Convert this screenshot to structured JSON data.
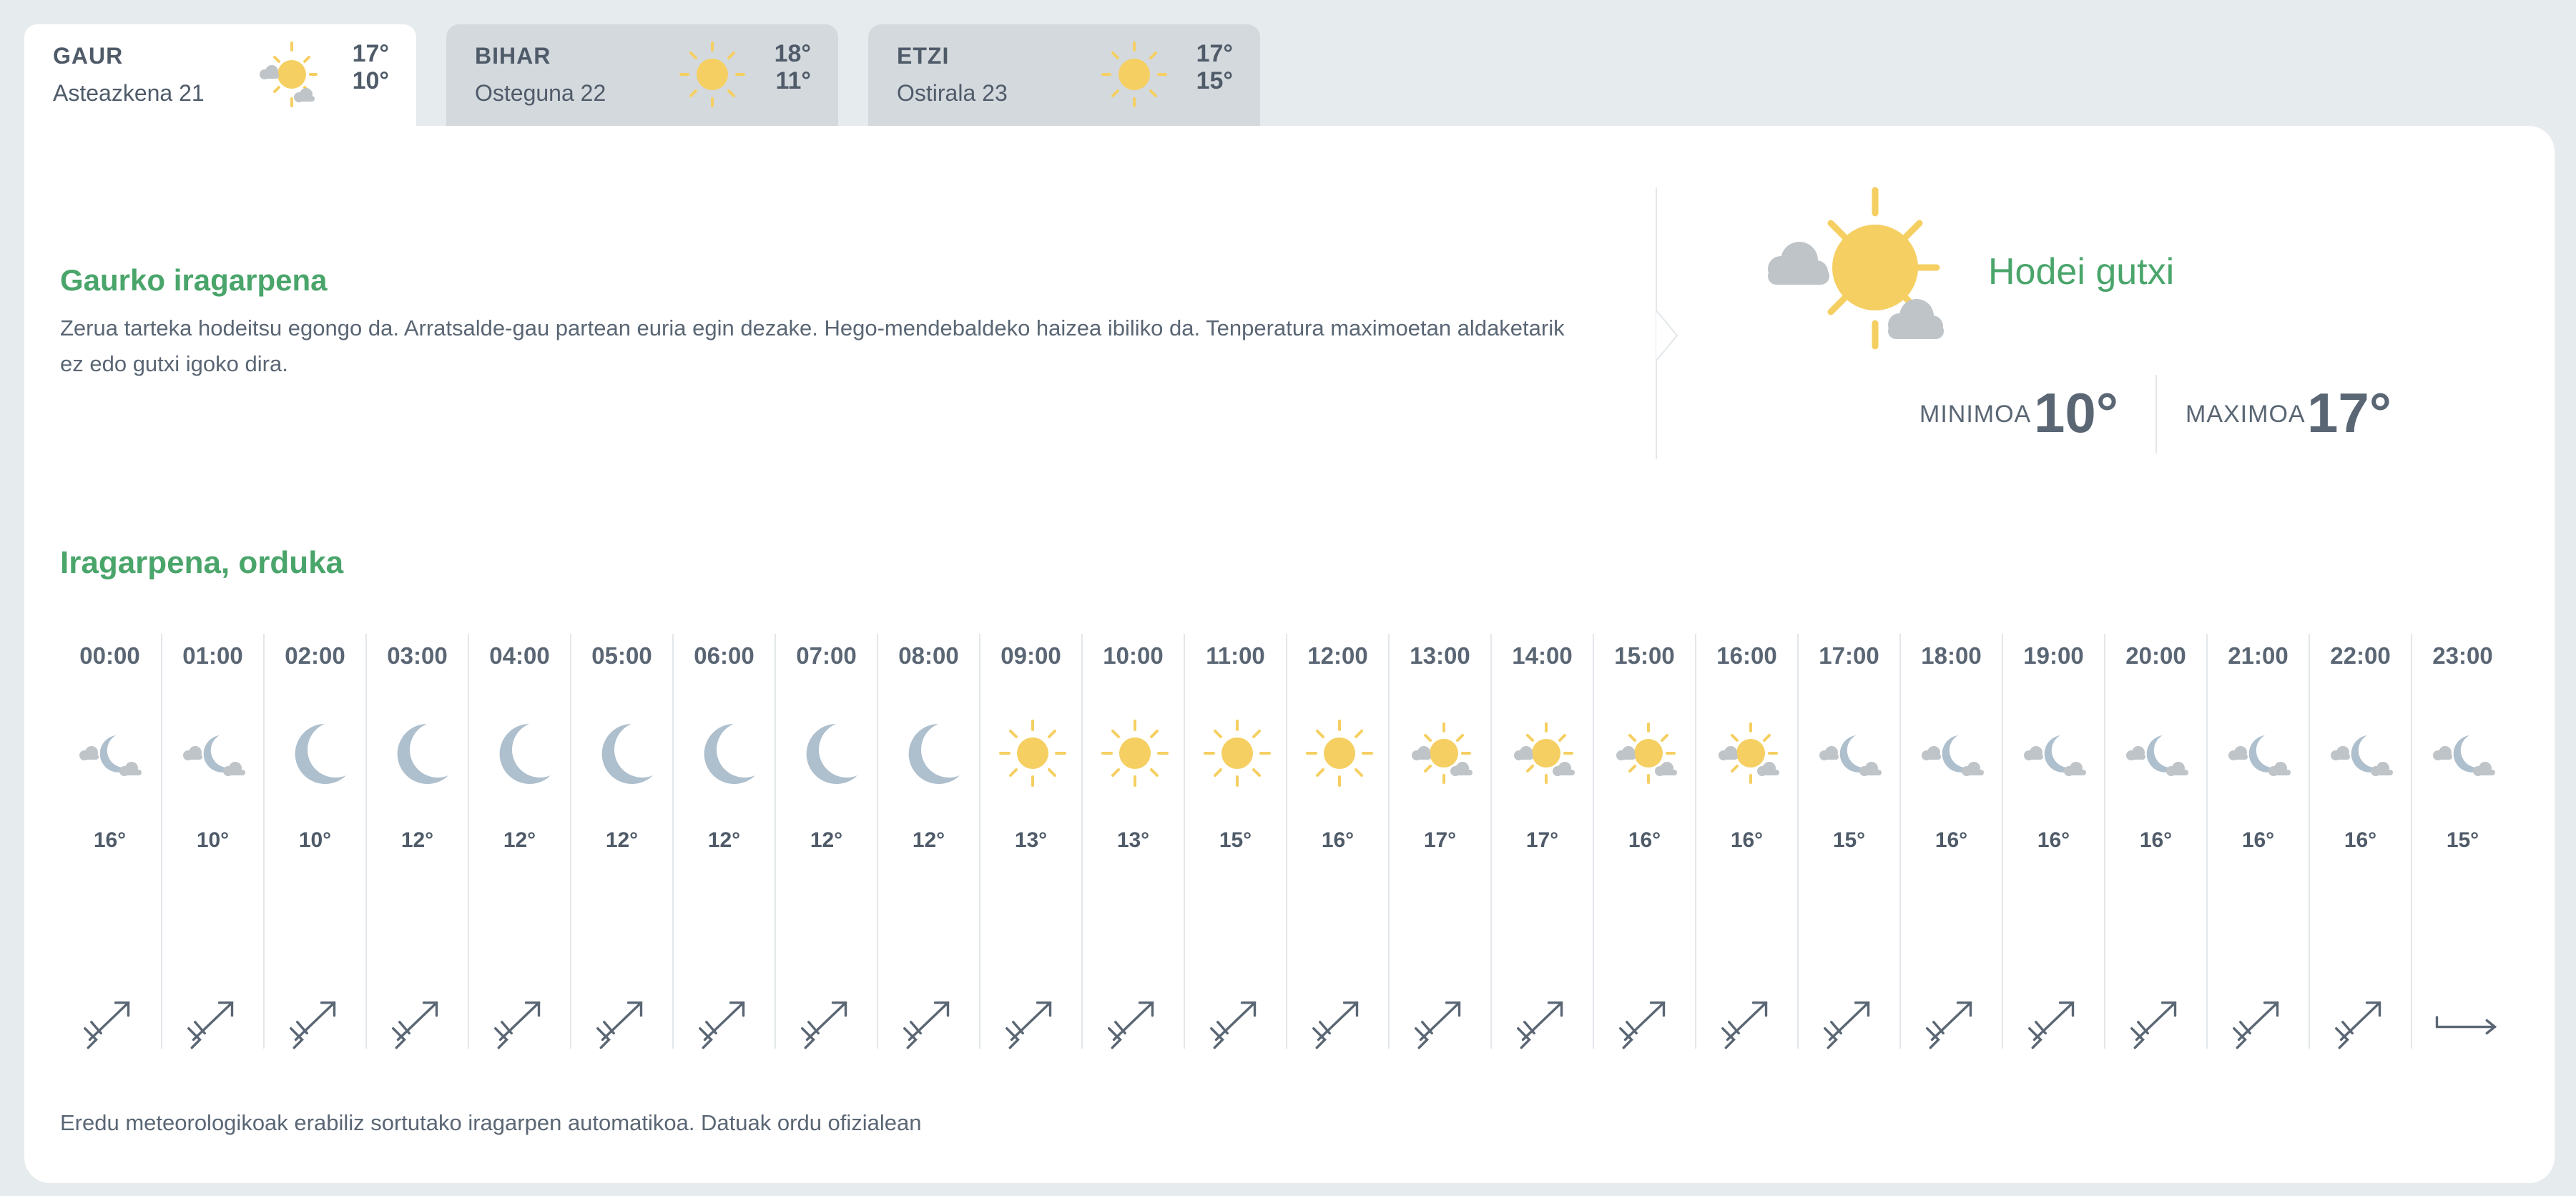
{
  "colors": {
    "accent": "#4aa56b",
    "text": "#4f5b69",
    "sun": "#f5cf61",
    "cloud": "#bfc4c8",
    "moon": "#aebfcd"
  },
  "tabs": [
    {
      "name": "GAUR",
      "date": "Asteazkena 21",
      "max": "17°",
      "min": "10°",
      "icon": "sun-cloud-icon",
      "active": true
    },
    {
      "name": "BIHAR",
      "date": "Osteguna 22",
      "max": "18°",
      "min": "11°",
      "icon": "sun-icon",
      "active": false
    },
    {
      "name": "ETZI",
      "date": "Ostirala 23",
      "max": "17°",
      "min": "15°",
      "icon": "sun-icon",
      "active": false
    }
  ],
  "today": {
    "title": "Gaurko iragarpena",
    "text": "Zerua tarteka hodeitsu egongo da. Arratsalde-gau partean euria egin dezake. Hego-mendebaldeko haizea ibiliko da. Tenperatura maximoetan aldaketarik ez edo gutxi igoko dira.",
    "sky_state": "Hodei gutxi",
    "min_label": "MINIMOA",
    "min_value": "10°",
    "max_label": "MAXIMOA",
    "max_value": "17°"
  },
  "hourly": {
    "title": "Iragarpena, orduka",
    "items": [
      {
        "time": "00:00",
        "icon": "moon-cloud-icon",
        "temp": "16°",
        "wind": "ne"
      },
      {
        "time": "01:00",
        "icon": "moon-cloud-icon",
        "temp": "10°",
        "wind": "ne"
      },
      {
        "time": "02:00",
        "icon": "moon-icon",
        "temp": "10°",
        "wind": "ne"
      },
      {
        "time": "03:00",
        "icon": "moon-icon",
        "temp": "12°",
        "wind": "ne"
      },
      {
        "time": "04:00",
        "icon": "moon-icon",
        "temp": "12°",
        "wind": "ne"
      },
      {
        "time": "05:00",
        "icon": "moon-icon",
        "temp": "12°",
        "wind": "ne"
      },
      {
        "time": "06:00",
        "icon": "moon-icon",
        "temp": "12°",
        "wind": "ne"
      },
      {
        "time": "07:00",
        "icon": "moon-icon",
        "temp": "12°",
        "wind": "ne"
      },
      {
        "time": "08:00",
        "icon": "moon-icon",
        "temp": "12°",
        "wind": "ne"
      },
      {
        "time": "09:00",
        "icon": "sun-icon",
        "temp": "13°",
        "wind": "ne"
      },
      {
        "time": "10:00",
        "icon": "sun-icon",
        "temp": "13°",
        "wind": "ne"
      },
      {
        "time": "11:00",
        "icon": "sun-icon",
        "temp": "15°",
        "wind": "ne"
      },
      {
        "time": "12:00",
        "icon": "sun-icon",
        "temp": "16°",
        "wind": "ne"
      },
      {
        "time": "13:00",
        "icon": "sun-cloud-icon",
        "temp": "17°",
        "wind": "ne"
      },
      {
        "time": "14:00",
        "icon": "sun-cloud-icon",
        "temp": "17°",
        "wind": "ne"
      },
      {
        "time": "15:00",
        "icon": "sun-cloud-icon",
        "temp": "16°",
        "wind": "ne"
      },
      {
        "time": "16:00",
        "icon": "sun-cloud-icon",
        "temp": "16°",
        "wind": "ne"
      },
      {
        "time": "17:00",
        "icon": "moon-cloud-icon",
        "temp": "15°",
        "wind": "ne"
      },
      {
        "time": "18:00",
        "icon": "moon-cloud-icon",
        "temp": "16°",
        "wind": "ne"
      },
      {
        "time": "19:00",
        "icon": "moon-cloud-icon",
        "temp": "16°",
        "wind": "ne"
      },
      {
        "time": "20:00",
        "icon": "moon-cloud-icon",
        "temp": "16°",
        "wind": "ne"
      },
      {
        "time": "21:00",
        "icon": "moon-cloud-icon",
        "temp": "16°",
        "wind": "ne"
      },
      {
        "time": "22:00",
        "icon": "moon-cloud-icon",
        "temp": "16°",
        "wind": "ne"
      },
      {
        "time": "23:00",
        "icon": "moon-cloud-icon",
        "temp": "15°",
        "wind": "e"
      }
    ]
  },
  "footnote": "Eredu meteorologikoak erabiliz sortutako iragarpen automatikoa. Datuak ordu ofizialean"
}
